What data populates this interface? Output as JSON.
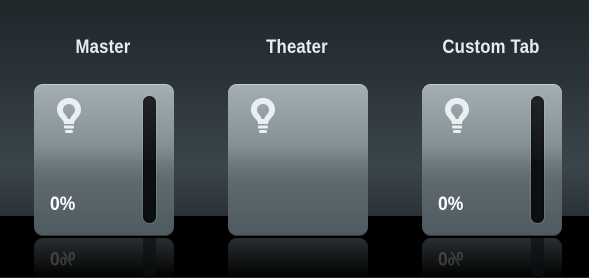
{
  "panels": [
    {
      "title": "Master",
      "icon": "lightbulb-icon",
      "level_text": "0%",
      "level": 0,
      "has_slider": true
    },
    {
      "title": "Theater",
      "icon": "lightbulb-icon",
      "level_text": "",
      "level": null,
      "has_slider": false
    },
    {
      "title": "Custom Tab",
      "icon": "lightbulb-icon",
      "level_text": "0%",
      "level": 0,
      "has_slider": true
    }
  ],
  "colors": {
    "title_text": "#e6ecef",
    "tile_top": "#9aa6ab",
    "tile_bottom": "#4e5a60",
    "slider_track": "#0c0f11",
    "background_top": "#20272b",
    "floor": "#000000"
  }
}
